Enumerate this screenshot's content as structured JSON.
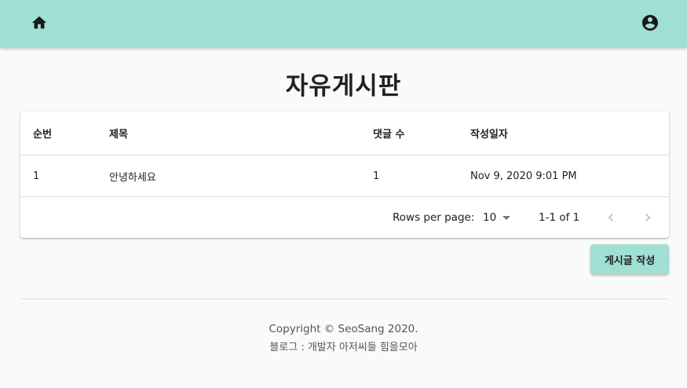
{
  "header": {
    "home_icon": "home-icon",
    "account_icon": "account-circle-icon",
    "background_color": "#9fdfd4"
  },
  "page": {
    "title": "자유게시판"
  },
  "table": {
    "columns": [
      "순번",
      "제목",
      "댓글 수",
      "작성일자"
    ],
    "rows": [
      {
        "no": "1",
        "title": "안녕하세요",
        "comments": "1",
        "date": "Nov 9, 2020 9:01 PM"
      }
    ]
  },
  "pagination": {
    "rows_per_page_label": "Rows per page:",
    "rows_per_page_value": "10",
    "range_text": "1-1 of 1",
    "prev_icon": "chevron-left-icon",
    "next_icon": "chevron-right-icon"
  },
  "actions": {
    "write_label": "게시글 작성"
  },
  "footer": {
    "copyright": "Copyright © SeoSang 2020.",
    "blog": "블로그 : 개발자 아저씨들 힘을모아"
  }
}
